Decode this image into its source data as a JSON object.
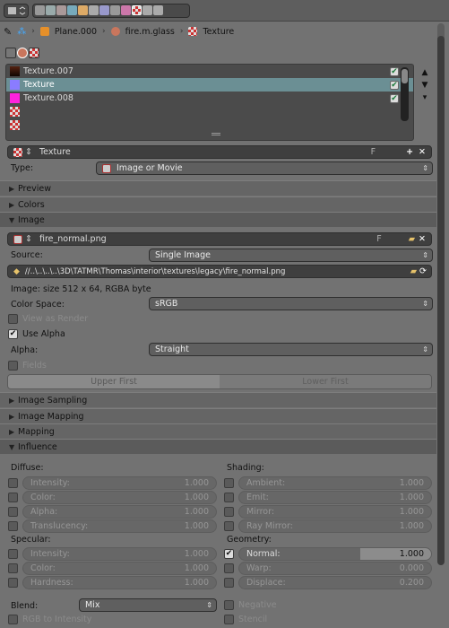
{
  "breadcrumb": {
    "object": "Plane.000",
    "material": "fire.m.glass",
    "texture": "Texture"
  },
  "texture_slots": [
    {
      "name": "Texture.007",
      "color": "#3a1a0a",
      "enabled": true,
      "selected": false
    },
    {
      "name": "Texture",
      "color": "#8a7cff",
      "enabled": true,
      "selected": true
    },
    {
      "name": "Texture.008",
      "color": "#ff22dd",
      "enabled": true,
      "selected": false
    }
  ],
  "datablock": {
    "name": "Texture",
    "users_label": "F"
  },
  "type": {
    "label": "Type:",
    "value": "Image or Movie"
  },
  "panels": {
    "preview": "Preview",
    "colors": "Colors",
    "image": "Image",
    "image_sampling": "Image Sampling",
    "image_mapping": "Image Mapping",
    "mapping": "Mapping",
    "influence": "Influence"
  },
  "image": {
    "file_name": "fire_normal.png",
    "users_label": "F",
    "source_label": "Source:",
    "source_value": "Single Image",
    "path": "//..\\..\\..\\..\\3D\\TATMR\\Thomas\\interior\\textures\\legacy\\fire_normal.png",
    "info": "Image: size 512 x 64, RGBA byte",
    "color_space_label": "Color Space:",
    "color_space_value": "sRGB",
    "view_as_render": "View as Render",
    "use_alpha": "Use Alpha",
    "alpha_label": "Alpha:",
    "alpha_value": "Straight",
    "fields": "Fields",
    "upper_first": "Upper First",
    "lower_first": "Lower First"
  },
  "influence": {
    "diffuse_title": "Diffuse:",
    "diffuse": [
      {
        "label": "Intensity:",
        "value": "1.000"
      },
      {
        "label": "Color:",
        "value": "1.000"
      },
      {
        "label": "Alpha:",
        "value": "1.000"
      },
      {
        "label": "Translucency:",
        "value": "1.000"
      }
    ],
    "shading_title": "Shading:",
    "shading": [
      {
        "label": "Ambient:",
        "value": "1.000"
      },
      {
        "label": "Emit:",
        "value": "1.000"
      },
      {
        "label": "Mirror:",
        "value": "1.000"
      },
      {
        "label": "Ray Mirror:",
        "value": "1.000"
      }
    ],
    "specular_title": "Specular:",
    "specular": [
      {
        "label": "Intensity:",
        "value": "1.000"
      },
      {
        "label": "Color:",
        "value": "1.000"
      },
      {
        "label": "Hardness:",
        "value": "1.000"
      }
    ],
    "geometry_title": "Geometry:",
    "geometry": [
      {
        "label": "Normal:",
        "value": "1.000",
        "enabled": true
      },
      {
        "label": "Warp:",
        "value": "0.000",
        "enabled": false
      },
      {
        "label": "Displace:",
        "value": "0.200",
        "enabled": false
      }
    ],
    "blend_label": "Blend:",
    "blend_value": "Mix",
    "negative": "Negative",
    "rgb_to_intensity": "RGB to Intensity",
    "stencil": "Stencil"
  },
  "colors": {
    "accent": "#6b8f94",
    "checkbox_on": "#dddddd"
  }
}
